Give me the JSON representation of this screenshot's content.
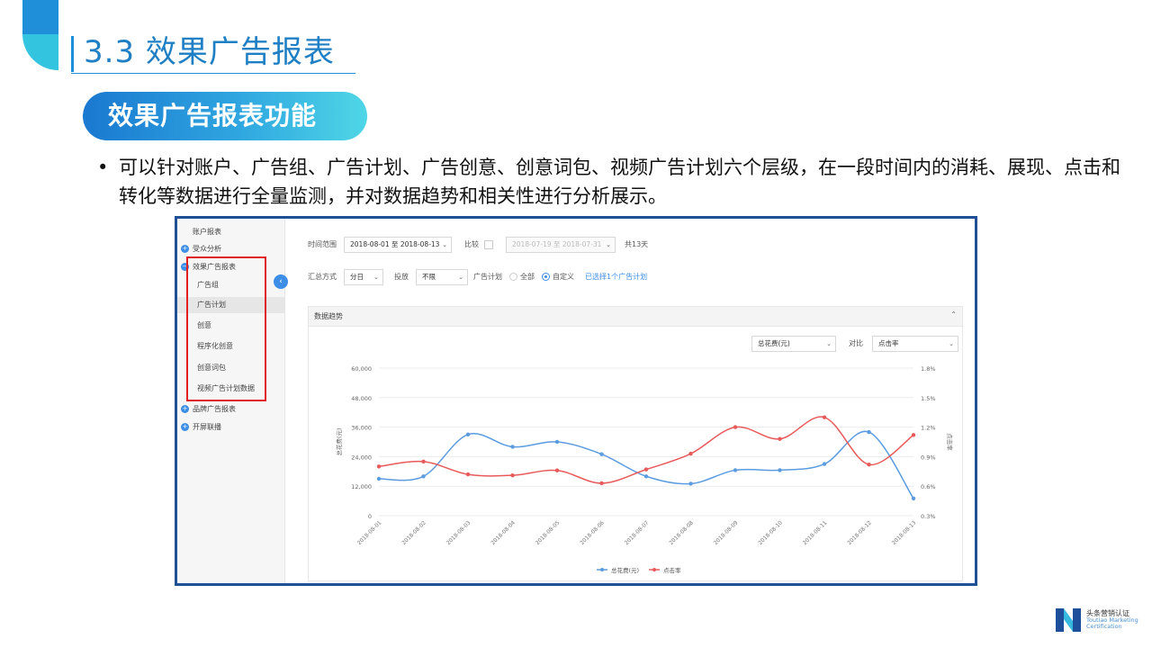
{
  "slide": {
    "title": "3.3 效果广告报表",
    "pill": "效果广告报表功能",
    "bullet_dot": "•",
    "bullet": "可以针对账户、广告组、广告计划、广告创意、创意词包、视频广告计划六个层级，在一段时间内的消耗、展现、点击和转化等数据进行全量监测，并对数据趋势和相关性进行分析展示。"
  },
  "sidebar": {
    "items": [
      {
        "label": "账户报表",
        "icon": ""
      },
      {
        "label": "受众分析",
        "icon": "plus-icon"
      },
      {
        "label": "效果广告报表",
        "icon": "minus-icon"
      },
      {
        "label": "广告组",
        "icon": ""
      },
      {
        "label": "广告计划",
        "icon": ""
      },
      {
        "label": "创意",
        "icon": ""
      },
      {
        "label": "程序化创意",
        "icon": ""
      },
      {
        "label": "创意词包",
        "icon": ""
      },
      {
        "label": "视频广告计划数据",
        "icon": ""
      },
      {
        "label": "品牌广告报表",
        "icon": "plus-icon"
      },
      {
        "label": "开屏联播",
        "icon": "plus-icon"
      }
    ],
    "plus_glyph": "+",
    "minus_glyph": "−",
    "collapse_glyph": "‹"
  },
  "filters": {
    "time_label": "时间范围",
    "date_range": "2018-08-01 至 2018-08-13",
    "compare_label": "比较",
    "compare_range": "2018-07-19 至 2018-07-31",
    "total_days": "共13天",
    "summary_label": "汇总方式",
    "summary_value": "分日",
    "placement_label": "投放",
    "placement_value": "不限",
    "plan_label": "广告计划",
    "plan_all": "全部",
    "plan_custom": "自定义",
    "plan_selected": "已选择1个广告计划",
    "chevron": "⌄"
  },
  "panel": {
    "title": "数据趋势",
    "caret": "⌃",
    "metric_left": "总花费(元)",
    "compare_label": "对比",
    "metric_right": "点击率"
  },
  "colors": {
    "blue_series": "#5b9be0",
    "red_series": "#e85a5a",
    "frame": "#1f4f95",
    "title": "#1e7fc4"
  },
  "chart_data": {
    "type": "line",
    "x": [
      "2018-08-01",
      "2018-08-02",
      "2018-08-03",
      "2018-08-04",
      "2018-08-05",
      "2018-08-06",
      "2018-08-07",
      "2018-08-08",
      "2018-08-09",
      "2018-08-10",
      "2018-08-11",
      "2018-08-12",
      "2018-08-13"
    ],
    "y_left_ticks": [
      "0",
      "12,000",
      "24,000",
      "36,000",
      "48,000",
      "60,000"
    ],
    "y_right_ticks": [
      "0.3%",
      "0.6%",
      "0.9%",
      "1.2%",
      "1.5%",
      "1.8%"
    ],
    "y_left_label": "总花费(元)",
    "y_right_label": "点击率",
    "ylim_left": [
      0,
      60000
    ],
    "ylim_right": [
      0.3,
      1.8
    ],
    "grid": true,
    "legend_position": "bottom",
    "series": [
      {
        "name": "总花费(元)",
        "axis": "left",
        "color": "#5b9be0",
        "values": [
          15000,
          16000,
          33000,
          28000,
          30000,
          25000,
          16000,
          13000,
          18500,
          18500,
          21000,
          34000,
          7000
        ]
      },
      {
        "name": "点击率",
        "axis": "right",
        "color": "#e85a5a",
        "values": [
          0.8,
          0.85,
          0.72,
          0.71,
          0.76,
          0.63,
          0.77,
          0.93,
          1.2,
          1.08,
          1.3,
          0.82,
          1.12
        ]
      }
    ]
  },
  "logo": {
    "cn": "头条营销认证",
    "en": "Toutiao Marketing Certification"
  }
}
